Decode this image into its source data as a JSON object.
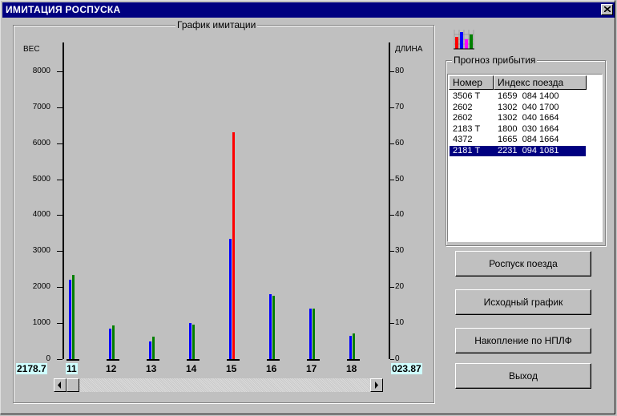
{
  "window": {
    "title": "ИМИТАЦИЯ  РОСПУСКА"
  },
  "chart_group": {
    "label": "График имитации"
  },
  "forecast_group": {
    "label": "Прогноз прибытия"
  },
  "icons": {
    "chart": "bar-chart-icon",
    "close": "close-icon"
  },
  "colors": {
    "blue": "#0000ff",
    "green": "#008000",
    "red": "#ff0000",
    "selection": "#000080",
    "value_box": "#cfffff"
  },
  "chart_data": {
    "type": "bar",
    "left_axis": {
      "label": "ВЕС",
      "min": 0,
      "max": 8800,
      "ticks": [
        0,
        1000,
        2000,
        3000,
        4000,
        5000,
        6000,
        7000,
        8000
      ]
    },
    "right_axis": {
      "label": "ДЛИНА",
      "min": 0,
      "max": 88,
      "ticks": [
        0,
        10,
        20,
        30,
        40,
        50,
        60,
        70,
        80
      ]
    },
    "categories": [
      "11",
      "12",
      "13",
      "14",
      "15",
      "16",
      "17",
      "18"
    ],
    "series": [
      {
        "axis": "left",
        "color": "#0000ff",
        "values": [
          2200,
          850,
          480,
          1000,
          3350,
          1800,
          1400,
          650
        ]
      },
      {
        "axis": "right",
        "color": "#008000",
        "values": [
          23.5,
          9.3,
          6.2,
          9.5,
          0,
          17.5,
          14.1,
          7.2
        ]
      },
      {
        "axis": "right",
        "color": "#ff0000",
        "values": [
          0,
          0,
          0,
          0,
          63,
          0,
          0,
          0
        ]
      }
    ],
    "left_readout": "2178.7",
    "right_readout": "023.87"
  },
  "forecast_table": {
    "columns": [
      "Номер",
      "Индекс поезда"
    ],
    "rows": [
      {
        "number": "3506 Т",
        "index": "1659  084 1400"
      },
      {
        "number": "2602",
        "index": "1302  040 1700"
      },
      {
        "number": "2602",
        "index": "1302  040 1664"
      },
      {
        "number": "2183 Т",
        "index": "1800  030 1664"
      },
      {
        "number": "4372",
        "index": "1665  084 1664"
      },
      {
        "number": "2181 Т",
        "index": "2231  094 1081"
      }
    ],
    "selected_row": 5
  },
  "buttons": {
    "dissolve": "Роспуск поезда",
    "initial": "Исходный график",
    "accumulation": "Накопление по НПЛФ",
    "exit": "Выход"
  }
}
